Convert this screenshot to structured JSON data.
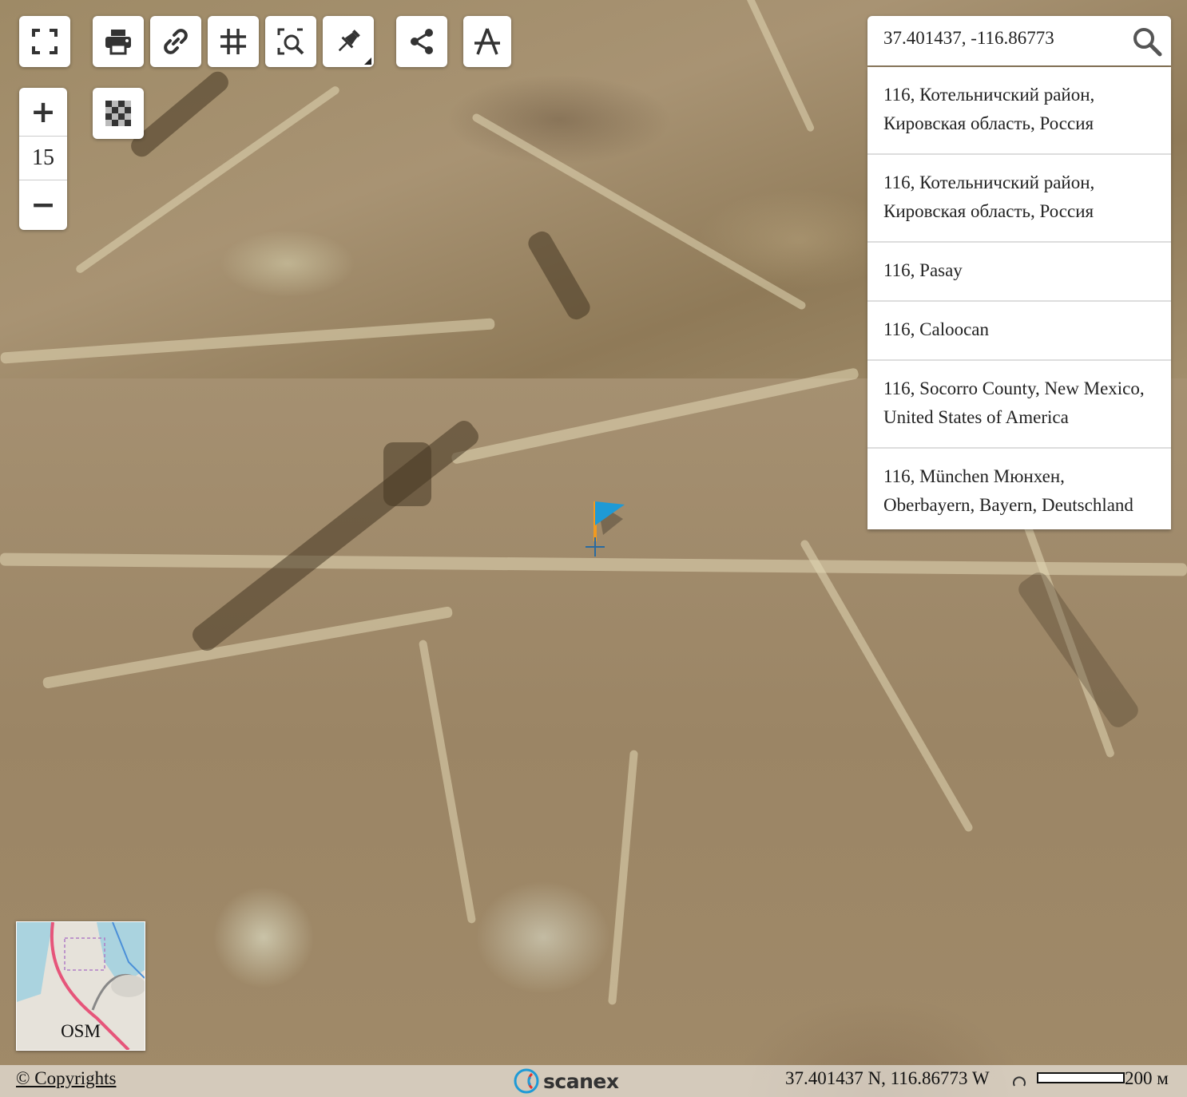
{
  "toolbar": {
    "buttons": [
      {
        "id": "fullscreen",
        "icon": "fullscreen-icon"
      },
      {
        "id": "print",
        "icon": "print-icon"
      },
      {
        "id": "permalink",
        "icon": "link-icon"
      },
      {
        "id": "grid",
        "icon": "grid-icon"
      },
      {
        "id": "zoom-box",
        "icon": "zoom-box-icon"
      },
      {
        "id": "marker",
        "icon": "pushpin-icon"
      },
      {
        "id": "share",
        "icon": "share-icon"
      },
      {
        "id": "drawing",
        "icon": "compass-icon"
      }
    ],
    "layer_switch_icon": "checkerboard-icon"
  },
  "zoom": {
    "plus": "+",
    "level": "15",
    "minus": "−"
  },
  "search": {
    "value": "37.401437, -116.86773",
    "icon": "search-icon",
    "results": [
      {
        "line1": "116, Котельничский район,",
        "line2": "Кировская область, Россия"
      },
      {
        "line1": "116, Котельничский район,",
        "line2": "Кировская область, Россия"
      },
      {
        "line1": "116, Pasay",
        "line2": ""
      },
      {
        "line1": "116, Caloocan",
        "line2": ""
      },
      {
        "line1": "116, Socorro County, New Mexico,",
        "line2": "United States of America"
      },
      {
        "line1": "116, München Мюнхен,",
        "line2": "Oberbayern, Bayern, Deutschland"
      }
    ]
  },
  "marker": {
    "icon": "flag-icon",
    "color": "#1e9ad6"
  },
  "minimap": {
    "label": "OSM"
  },
  "footer": {
    "copyright": "© Copyrights",
    "logo_text": "scanex",
    "coordinates": "37.401437 N, 116.86773 W",
    "scale_label": "200 м"
  },
  "colors": {
    "accent": "#1e9ad6",
    "flag_pole": "#f29a1f"
  }
}
